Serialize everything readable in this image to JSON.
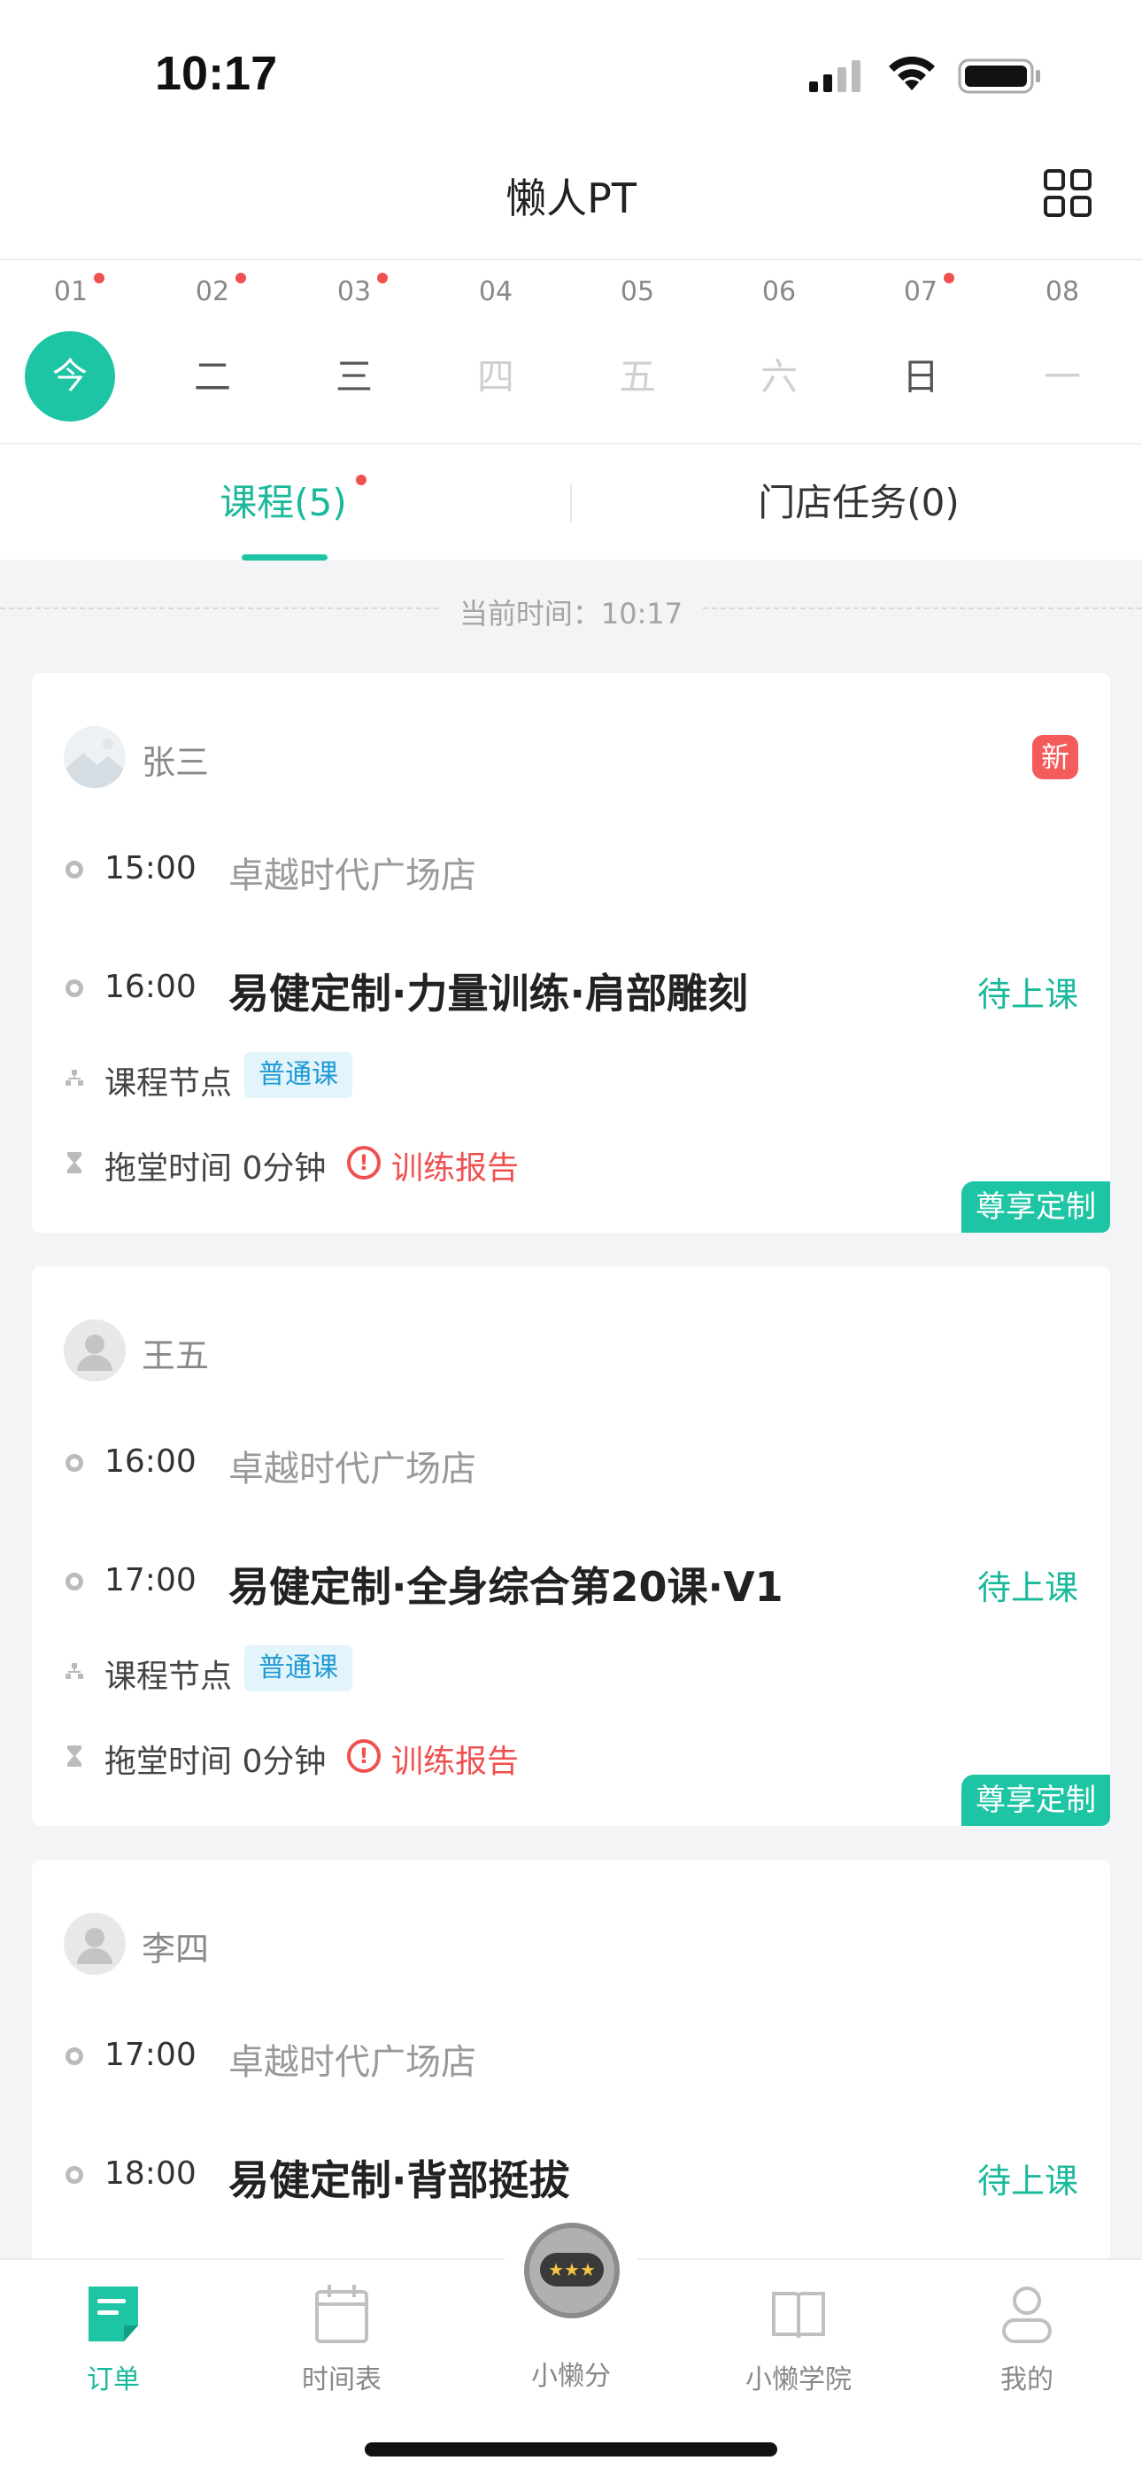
{
  "status_bar": {
    "time": "10:17"
  },
  "header": {
    "title": "懒人PT"
  },
  "week": [
    {
      "num": "01",
      "label": "今",
      "today": true,
      "dot": true,
      "dim": false
    },
    {
      "num": "02",
      "label": "二",
      "today": false,
      "dot": true,
      "dim": false
    },
    {
      "num": "03",
      "label": "三",
      "today": false,
      "dot": true,
      "dim": false
    },
    {
      "num": "04",
      "label": "四",
      "today": false,
      "dot": false,
      "dim": true
    },
    {
      "num": "05",
      "label": "五",
      "today": false,
      "dot": false,
      "dim": true
    },
    {
      "num": "06",
      "label": "六",
      "today": false,
      "dot": false,
      "dim": true
    },
    {
      "num": "07",
      "label": "日",
      "today": false,
      "dot": true,
      "dim": false
    },
    {
      "num": "08",
      "label": "一",
      "today": false,
      "dot": false,
      "dim": true
    }
  ],
  "tabs": {
    "course": "课程(5)",
    "task": "门店任务(0)"
  },
  "now_text": "当前时间：10:17",
  "cards": [
    {
      "name": "张三",
      "new_badge": "新",
      "store_time": "15:00",
      "store": "卓越时代广场店",
      "class_time": "16:00",
      "title": "易健定制·力量训练·肩部雕刻",
      "status": "待上课",
      "node_label": "课程节点",
      "tag": "普通课",
      "drag_label": "拖堂时间 0分钟",
      "report": "训练报告",
      "vip": "尊享定制"
    },
    {
      "name": "王五",
      "new_badge": "",
      "store_time": "16:00",
      "store": "卓越时代广场店",
      "class_time": "17:00",
      "title": "易健定制·全身综合第20课·V1",
      "status": "待上课",
      "node_label": "课程节点",
      "tag": "普通课",
      "drag_label": "拖堂时间 0分钟",
      "report": "训练报告",
      "vip": "尊享定制"
    },
    {
      "name": "李四",
      "new_badge": "",
      "store_time": "17:00",
      "store": "卓越时代广场店",
      "class_time": "18:00",
      "title": "易健定制·背部挺拔",
      "status": "待上课"
    }
  ],
  "bottom_nav": [
    {
      "label": "订单",
      "active": true,
      "icon": "order-icon"
    },
    {
      "label": "时间表",
      "active": false,
      "icon": "calendar-icon"
    },
    {
      "label": "小懒分",
      "active": false,
      "icon": "robot-icon"
    },
    {
      "label": "小懒学院",
      "active": false,
      "icon": "book-icon"
    },
    {
      "label": "我的",
      "active": false,
      "icon": "profile-icon"
    }
  ],
  "colors": {
    "accent": "#1ec5a5",
    "alert": "#f05050",
    "tag_bg": "#e3f4fb",
    "tag_text": "#1e9ad6"
  }
}
